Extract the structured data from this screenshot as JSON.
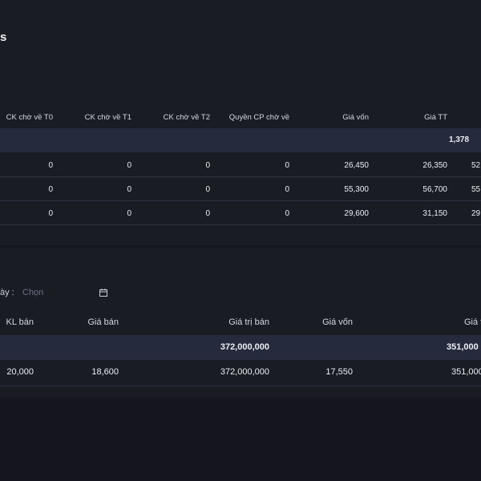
{
  "section1": {
    "title_fragment": "s",
    "columns": [
      "CK chờ về T0",
      "CK chờ về T1",
      "CK chờ về T2",
      "Quyền CP chờ về",
      "Giá vốn",
      "Giá TT"
    ],
    "total_value": "1,378",
    "rows": [
      {
        "t0": "0",
        "t1": "0",
        "t2": "0",
        "quyen": "0",
        "gia_von": "26,450",
        "gia_tt": "26,350",
        "extra": "52"
      },
      {
        "t0": "0",
        "t1": "0",
        "t2": "0",
        "quyen": "0",
        "gia_von": "55,300",
        "gia_tt": "56,700",
        "extra": "55"
      },
      {
        "t0": "0",
        "t1": "0",
        "t2": "0",
        "quyen": "0",
        "gia_von": "29,600",
        "gia_tt": "31,150",
        "extra": "29"
      }
    ]
  },
  "section2": {
    "filter_label": "ày :",
    "filter_placeholder": "Chọn",
    "calendar_icon": "calendar-icon",
    "columns": [
      "KL bán",
      "Giá bán",
      "Giá trị bán",
      "Giá vốn",
      "Giá t"
    ],
    "totals": {
      "gia_tri_ban": "372,000,000",
      "last": "351,000"
    },
    "rows": [
      {
        "kl_ban": "20,000",
        "gia_ban": "18,600",
        "gia_tri_ban": "372,000,000",
        "gia_von": "17,550",
        "last": "351,000"
      }
    ]
  }
}
